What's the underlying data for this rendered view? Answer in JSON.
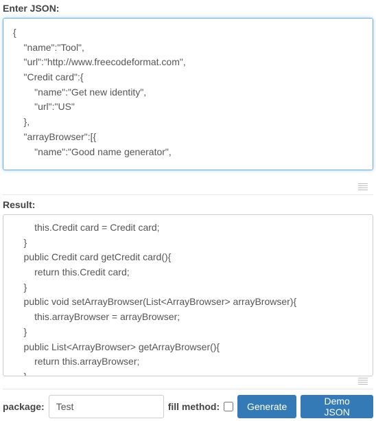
{
  "input": {
    "label": "Enter JSON:",
    "value": "{\n    \"name\":\"Tool\",\n    \"url\":\"http://www.freecodeformat.com\",\n    \"Credit card\":{\n        \"name\":\"Get new identity\",\n        \"url\":\"US\"\n    },\n    \"arrayBrowser\":[{\n        \"name\":\"Good name generator\",\n"
  },
  "result": {
    "label": "Result:",
    "value": "        this.Credit card = Credit card;\n    }\n    public Credit card getCredit card(){\n        return this.Credit card;\n    }\n    public void setArrayBrowser(List<ArrayBrowser> arrayBrowser){\n        this.arrayBrowser = arrayBrowser;\n    }\n    public List<ArrayBrowser> getArrayBrowser(){\n        return this.arrayBrowser;\n    }\n}"
  },
  "footer": {
    "package_label": "package:",
    "package_value": "Test",
    "fill_method_label": "fill method:",
    "generate_label": "Generate",
    "demo_label": "Demo JSON"
  }
}
